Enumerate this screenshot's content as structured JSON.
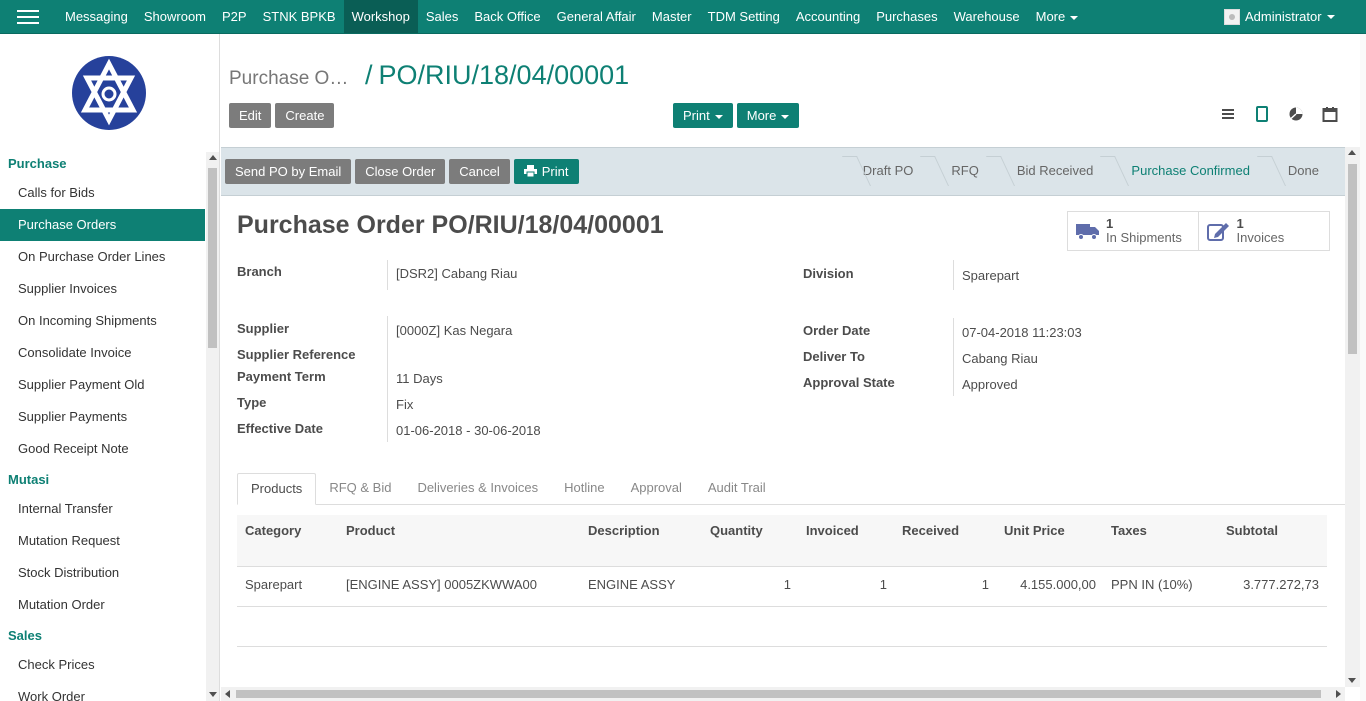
{
  "topnav": {
    "items": [
      "Messaging",
      "Showroom",
      "P2P",
      "STNK BPKB",
      "Workshop",
      "Sales",
      "Back Office",
      "General Affair",
      "Master",
      "TDM Setting",
      "Accounting",
      "Purchases",
      "Warehouse"
    ],
    "more_label": "More",
    "user_name": "Administrator"
  },
  "sidebar": {
    "sections": [
      {
        "title": "Purchase",
        "items": [
          "Calls for Bids",
          "Purchase Orders",
          "On Purchase Order Lines",
          "Supplier Invoices",
          "On Incoming Shipments",
          "Consolidate Invoice",
          "Supplier Payment Old",
          "Supplier Payments",
          "Good Receipt Note"
        ]
      },
      {
        "title": "Mutasi",
        "items": [
          "Internal Transfer",
          "Mutation Request",
          "Stock Distribution",
          "Mutation Order"
        ]
      },
      {
        "title": "Sales",
        "items": [
          "Check Prices",
          "Work Order"
        ]
      }
    ],
    "active_item": "Purchase Orders"
  },
  "breadcrumb": {
    "parent": "Purchase Orders",
    "separator": "/",
    "current": "PO/RIU/18/04/00001"
  },
  "buttons": {
    "edit": "Edit",
    "create": "Create",
    "print": "Print",
    "more": "More"
  },
  "statusbar": {
    "actions": {
      "send_email": "Send PO by Email",
      "close_order": "Close Order",
      "cancel": "Cancel",
      "print": "Print"
    },
    "stages": [
      "Draft PO",
      "RFQ",
      "Bid Received",
      "Purchase Confirmed",
      "Done"
    ],
    "active_stage": "Purchase Confirmed"
  },
  "form": {
    "title_prefix": "Purchase Order",
    "title_number": "PO/RIU/18/04/00001",
    "smart_buttons": {
      "shipments": {
        "count": "1",
        "label": "In Shipments"
      },
      "invoices": {
        "count": "1",
        "label": "Invoices"
      }
    },
    "fields": {
      "branch": {
        "label": "Branch",
        "value": "[DSR2] Cabang Riau"
      },
      "division": {
        "label": "Division",
        "value": "Sparepart"
      },
      "supplier": {
        "label": "Supplier",
        "value": "[0000Z] Kas Negara"
      },
      "supplier_reference": {
        "label": "Supplier Reference",
        "value": ""
      },
      "payment_term": {
        "label": "Payment Term",
        "value": "11 Days"
      },
      "type": {
        "label": "Type",
        "value": "Fix"
      },
      "effective_date": {
        "label": "Effective Date",
        "start": "01-06-2018",
        "sep": "-",
        "end": "30-06-2018"
      },
      "order_date": {
        "label": "Order Date",
        "value": "07-04-2018 11:23:03"
      },
      "deliver_to": {
        "label": "Deliver To",
        "value": "Cabang Riau"
      },
      "approval_state": {
        "label": "Approval State",
        "value": "Approved"
      }
    }
  },
  "tabs": [
    "Products",
    "RFQ & Bid",
    "Deliveries & Invoices",
    "Hotline",
    "Approval",
    "Audit Trail"
  ],
  "active_tab": "Products",
  "table": {
    "headers": [
      "Category",
      "Product",
      "Description",
      "Quantity",
      "Invoiced",
      "Received",
      "Unit Price",
      "Taxes",
      "Subtotal"
    ],
    "rows": [
      [
        "Sparepart",
        "[ENGINE ASSY] 0005ZKWWA00",
        "ENGINE ASSY",
        "1",
        "1",
        "1",
        "4.155.000,00",
        "PPN IN (10%)",
        "3.777.272,73"
      ]
    ]
  },
  "colors": {
    "brand": "#0e8074",
    "logo": "#26419b"
  }
}
